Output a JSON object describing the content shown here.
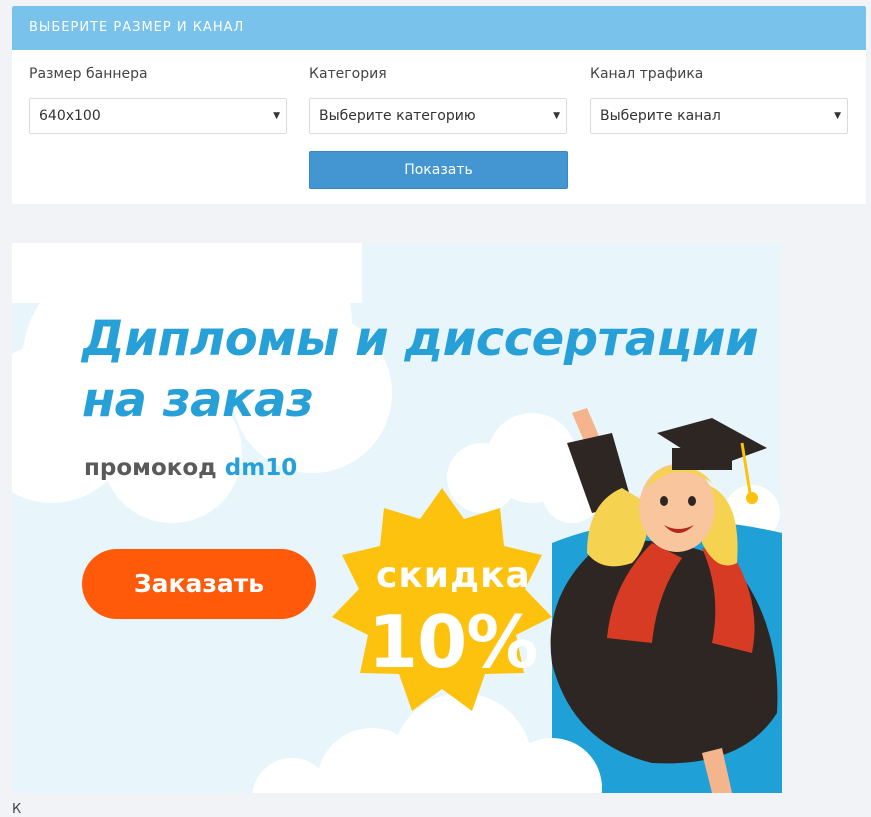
{
  "panel": {
    "header": "ВЫБЕРИТЕ РАЗМЕР И КАНАЛ",
    "fields": [
      {
        "label": "Размер баннера",
        "value": "640x100"
      },
      {
        "label": "Категория",
        "value": "Выберите категорию"
      },
      {
        "label": "Канал трафика",
        "value": "Выберите канал"
      }
    ],
    "show_button": "Показать"
  },
  "banner": {
    "title_line1": "Дипломы и диссертации",
    "title_line2": "на заказ",
    "promo_label": "промокод",
    "promo_code": "dm10",
    "order_button": "Заказать",
    "discount_label": "скидка",
    "discount_value": "10%"
  },
  "footer": {
    "text": "К"
  },
  "colors": {
    "header_bg": "#78c2ec",
    "button_bg": "#4496d3",
    "banner_title": "#26a0d6",
    "order_button": "#ff5a0a",
    "badge": "#fdc20d"
  }
}
